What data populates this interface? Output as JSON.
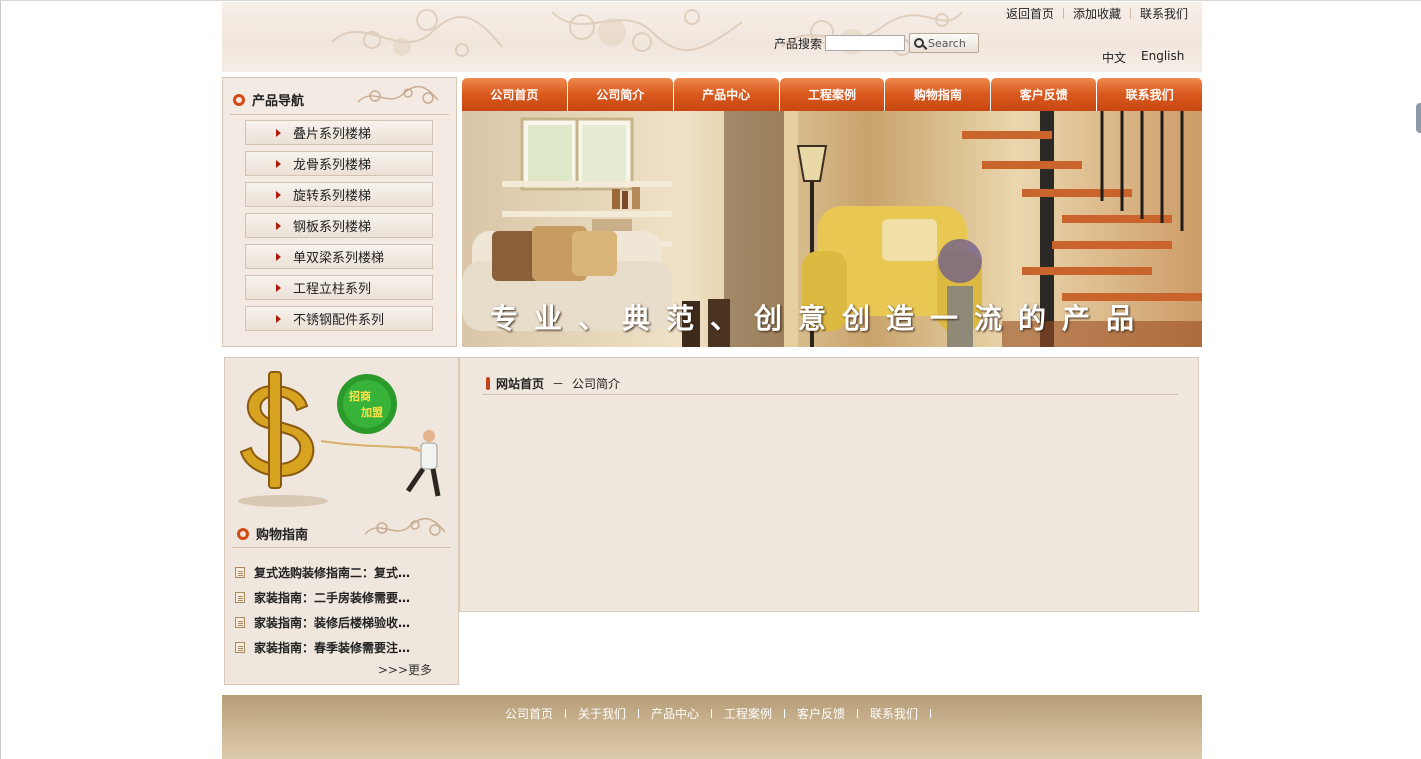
{
  "header": {
    "top_links": [
      "返回首页",
      "添加收藏",
      "联系我们"
    ],
    "search_label": "产品搜索",
    "search_value": "",
    "search_button": "Search",
    "languages": [
      "中文",
      "English"
    ]
  },
  "product_nav": {
    "title": "产品导航",
    "items": [
      "叠片系列楼梯",
      "龙骨系列楼梯",
      "旋转系列楼梯",
      "钢板系列楼梯",
      "单双梁系列楼梯",
      "工程立柱系列",
      "不锈钢配件系列"
    ]
  },
  "main_nav": [
    "公司首页",
    "公司简介",
    "产品中心",
    "工程案例",
    "购物指南",
    "客户反馈",
    "联系我们"
  ],
  "banner": {
    "slogan": "专业、典范、创意创造一流的产品"
  },
  "promo": {
    "badge": [
      "招商",
      "加盟"
    ]
  },
  "shopping_guide": {
    "title": "购物指南",
    "items": [
      "复式选购装修指南二：复式…",
      "家装指南：二手房装修需要…",
      "家装指南：装修后楼梯验收…",
      "家装指南：春季装修需要注…"
    ],
    "more": ">>>更多"
  },
  "breadcrumb": {
    "home": "网站首页",
    "separator": "－",
    "current": "公司简介"
  },
  "footer": {
    "links": [
      "公司首页",
      "关于我们",
      "产品中心",
      "工程案例",
      "客户反馈",
      "联系我们"
    ]
  },
  "colors": {
    "accent": "#d9581d",
    "panel": "#f0e7de",
    "footer": "#c9b28e"
  }
}
